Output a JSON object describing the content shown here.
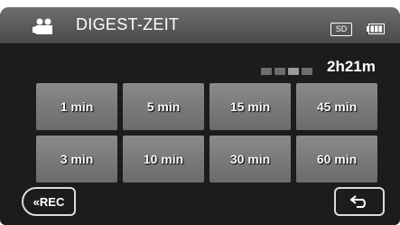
{
  "header": {
    "title": "DIGEST-ZEIT",
    "camera_icon": "video-camera-icon",
    "media_badge": "SD",
    "battery_icon": "battery-full-icon"
  },
  "status": {
    "remaining_time": "2h21m"
  },
  "digest_options": [
    {
      "label": "1 min"
    },
    {
      "label": "5 min"
    },
    {
      "label": "15 min"
    },
    {
      "label": "45 min"
    },
    {
      "label": "3 min"
    },
    {
      "label": "10 min"
    },
    {
      "label": "30 min"
    },
    {
      "label": "60 min"
    }
  ],
  "footer": {
    "rec_label": "«REC",
    "back_icon": "return-arrow-icon"
  },
  "colors": {
    "header": "#5a5a5a",
    "screen": "#1c1c1c",
    "button": "#7a7a7a",
    "text": "#ffffff"
  }
}
